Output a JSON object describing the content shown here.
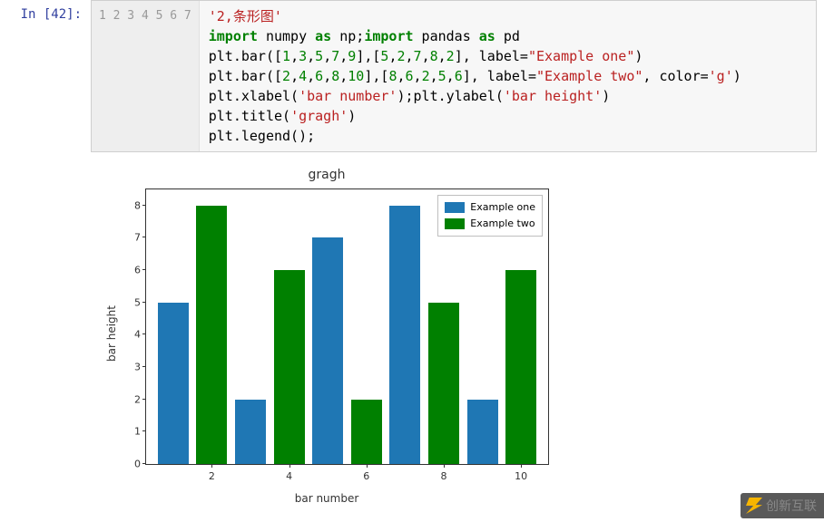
{
  "cell": {
    "prompt": "In [42]:",
    "line_numbers": [
      "1",
      "2",
      "3",
      "4",
      "5",
      "6",
      "7"
    ],
    "code_tokens": [
      [
        {
          "t": "'2,条形图'",
          "c": "s-str"
        }
      ],
      [
        {
          "t": "import",
          "c": "s-kw"
        },
        {
          "t": " numpy ",
          "c": "s-id"
        },
        {
          "t": "as",
          "c": "s-kw"
        },
        {
          "t": " np;",
          "c": "s-id"
        },
        {
          "t": "import",
          "c": "s-kw"
        },
        {
          "t": " pandas ",
          "c": "s-id"
        },
        {
          "t": "as",
          "c": "s-kw"
        },
        {
          "t": " pd",
          "c": "s-id"
        }
      ],
      [
        {
          "t": "plt.bar([",
          "c": "s-id"
        },
        {
          "t": "1",
          "c": "s-num"
        },
        {
          "t": ",",
          "c": "s-id"
        },
        {
          "t": "3",
          "c": "s-num"
        },
        {
          "t": ",",
          "c": "s-id"
        },
        {
          "t": "5",
          "c": "s-num"
        },
        {
          "t": ",",
          "c": "s-id"
        },
        {
          "t": "7",
          "c": "s-num"
        },
        {
          "t": ",",
          "c": "s-id"
        },
        {
          "t": "9",
          "c": "s-num"
        },
        {
          "t": "],[",
          "c": "s-id"
        },
        {
          "t": "5",
          "c": "s-num"
        },
        {
          "t": ",",
          "c": "s-id"
        },
        {
          "t": "2",
          "c": "s-num"
        },
        {
          "t": ",",
          "c": "s-id"
        },
        {
          "t": "7",
          "c": "s-num"
        },
        {
          "t": ",",
          "c": "s-id"
        },
        {
          "t": "8",
          "c": "s-num"
        },
        {
          "t": ",",
          "c": "s-id"
        },
        {
          "t": "2",
          "c": "s-num"
        },
        {
          "t": "], label=",
          "c": "s-id"
        },
        {
          "t": "\"Example one\"",
          "c": "s-str"
        },
        {
          "t": ")",
          "c": "s-id"
        }
      ],
      [
        {
          "t": "plt.bar([",
          "c": "s-id"
        },
        {
          "t": "2",
          "c": "s-num"
        },
        {
          "t": ",",
          "c": "s-id"
        },
        {
          "t": "4",
          "c": "s-num"
        },
        {
          "t": ",",
          "c": "s-id"
        },
        {
          "t": "6",
          "c": "s-num"
        },
        {
          "t": ",",
          "c": "s-id"
        },
        {
          "t": "8",
          "c": "s-num"
        },
        {
          "t": ",",
          "c": "s-id"
        },
        {
          "t": "10",
          "c": "s-num"
        },
        {
          "t": "],[",
          "c": "s-id"
        },
        {
          "t": "8",
          "c": "s-num"
        },
        {
          "t": ",",
          "c": "s-id"
        },
        {
          "t": "6",
          "c": "s-num"
        },
        {
          "t": ",",
          "c": "s-id"
        },
        {
          "t": "2",
          "c": "s-num"
        },
        {
          "t": ",",
          "c": "s-id"
        },
        {
          "t": "5",
          "c": "s-num"
        },
        {
          "t": ",",
          "c": "s-id"
        },
        {
          "t": "6",
          "c": "s-num"
        },
        {
          "t": "], label=",
          "c": "s-id"
        },
        {
          "t": "\"Example two\"",
          "c": "s-str"
        },
        {
          "t": ", color=",
          "c": "s-id"
        },
        {
          "t": "'g'",
          "c": "s-str"
        },
        {
          "t": ")",
          "c": "s-id"
        }
      ],
      [
        {
          "t": "plt.xlabel(",
          "c": "s-id"
        },
        {
          "t": "'bar number'",
          "c": "s-str"
        },
        {
          "t": ");plt.ylabel(",
          "c": "s-id"
        },
        {
          "t": "'bar height'",
          "c": "s-str"
        },
        {
          "t": ")",
          "c": "s-id"
        }
      ],
      [
        {
          "t": "plt.title(",
          "c": "s-id"
        },
        {
          "t": "'gragh'",
          "c": "s-str"
        },
        {
          "t": ")",
          "c": "s-id"
        }
      ],
      [
        {
          "t": "plt.legend();",
          "c": "s-id"
        }
      ]
    ]
  },
  "chart_data": {
    "type": "bar",
    "title": "gragh",
    "xlabel": "bar number",
    "ylabel": "bar height",
    "xlim": [
      0.3,
      10.7
    ],
    "ylim": [
      0,
      8.5
    ],
    "xticks": [
      2,
      4,
      6,
      8,
      10
    ],
    "yticks": [
      0,
      1,
      2,
      3,
      4,
      5,
      6,
      7,
      8
    ],
    "bar_width": 0.8,
    "series": [
      {
        "name": "Example one",
        "color": "#1f77b4",
        "x": [
          1,
          3,
          5,
          7,
          9
        ],
        "values": [
          5,
          2,
          7,
          8,
          2
        ]
      },
      {
        "name": "Example two",
        "color": "#008000",
        "x": [
          2,
          4,
          6,
          8,
          10
        ],
        "values": [
          8,
          6,
          2,
          5,
          6
        ]
      }
    ]
  },
  "watermark": {
    "text": "创新互联"
  }
}
